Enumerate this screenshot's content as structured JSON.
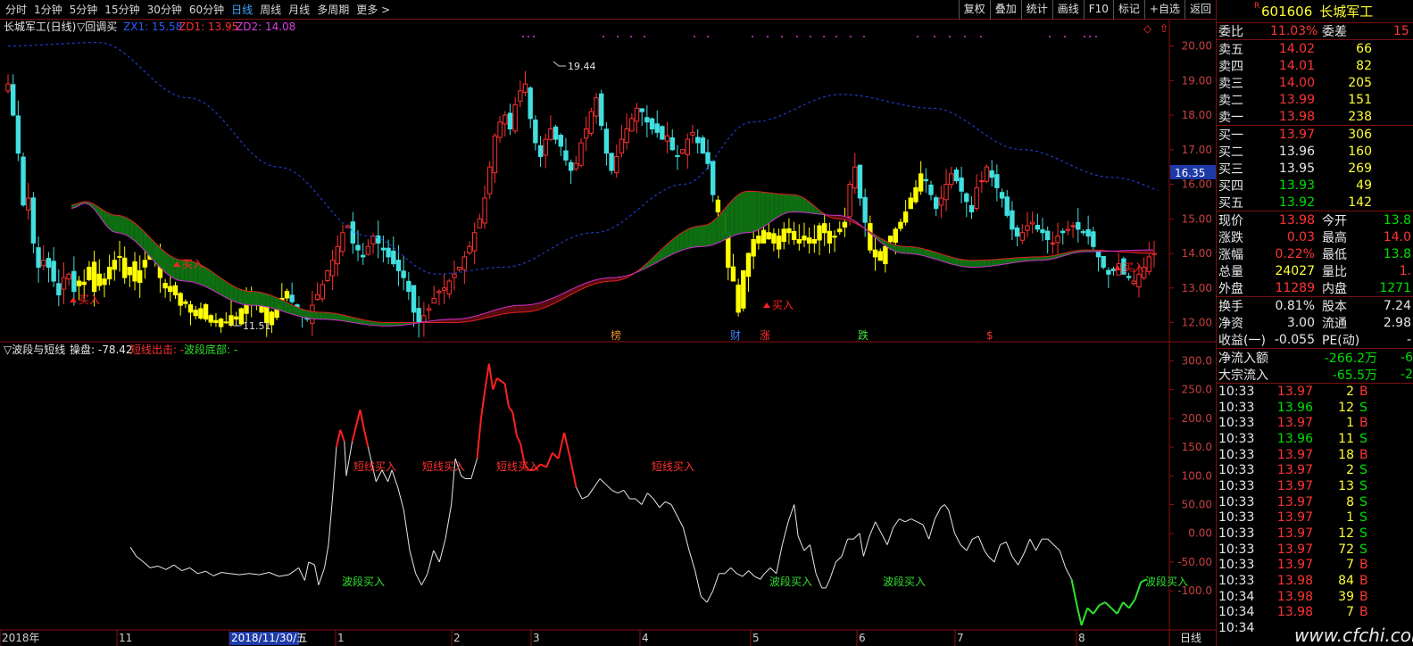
{
  "periods": [
    "分时",
    "1分钟",
    "5分钟",
    "15分钟",
    "30分钟",
    "60分钟",
    "日线",
    "周线",
    "月线",
    "多周期",
    "更多 >"
  ],
  "active_period": "日线",
  "tools": [
    "复权",
    "叠加",
    "统计",
    "画线",
    "F10",
    "标记",
    "+自选",
    "返回"
  ],
  "upper": {
    "label_name": "长城军工(日线)",
    "label_ind": "▽回调买",
    "zx1": "ZX1: 15.58",
    "zd1": "ZD1: 13.95",
    "zd2": "ZD2: 14.08",
    "y_ticks": [
      "20.00",
      "19.00",
      "18.00",
      "17.00",
      "16.00",
      "15.00",
      "14.00",
      "13.00",
      "12.00"
    ],
    "price_box": "16.35",
    "high_label": "19.44",
    "low_label": "11.51",
    "buy_label": "买入",
    "events": [
      "榜",
      "财",
      "涨",
      "跌",
      "$"
    ]
  },
  "lower": {
    "label_ind": "▽波段与短线",
    "label_op": "操盘: -78.42",
    "label_short": "短线出击: -",
    "label_wave": "波段底部: -",
    "y_ticks": [
      "300.0",
      "250.0",
      "200.0",
      "150.0",
      "100.0",
      "50.00",
      "0.00",
      "-50.00",
      "-100.0"
    ],
    "short_buy": "短线买入",
    "wave_buy": "波段买入"
  },
  "xaxis": {
    "labels": [
      "2018年",
      "11",
      "2018/11/30/五",
      "1",
      "2",
      "3",
      "4",
      "5",
      "6",
      "7",
      "8"
    ],
    "right": "日线"
  },
  "panel": {
    "code": "601606",
    "name": "长城军工",
    "rmark": "R",
    "weibi_label": "委比",
    "weibi": "11.03%",
    "weicha_label": "委差",
    "weicha": "15",
    "asks": [
      {
        "l": "卖五",
        "p": "14.02",
        "v": "66"
      },
      {
        "l": "卖四",
        "p": "14.01",
        "v": "82"
      },
      {
        "l": "卖三",
        "p": "14.00",
        "v": "205"
      },
      {
        "l": "卖二",
        "p": "13.99",
        "v": "151"
      },
      {
        "l": "卖一",
        "p": "13.98",
        "v": "238"
      }
    ],
    "bids": [
      {
        "l": "买一",
        "p": "13.97",
        "v": "306"
      },
      {
        "l": "买二",
        "p": "13.96",
        "v": "160"
      },
      {
        "l": "买三",
        "p": "13.95",
        "v": "269"
      },
      {
        "l": "买四",
        "p": "13.93",
        "v": "49"
      },
      {
        "l": "买五",
        "p": "13.92",
        "v": "142"
      }
    ],
    "quote": [
      {
        "l1": "现价",
        "v1": "13.98",
        "c1": "red",
        "l2": "今开",
        "v2": "13.8",
        "c2": "green"
      },
      {
        "l1": "涨跌",
        "v1": "0.03",
        "c1": "red",
        "l2": "最高",
        "v2": "14.0",
        "c2": "red"
      },
      {
        "l1": "涨幅",
        "v1": "0.22%",
        "c1": "red",
        "l2": "最低",
        "v2": "13.8",
        "c2": "green"
      },
      {
        "l1": "总量",
        "v1": "24027",
        "c1": "yellow",
        "l2": "量比",
        "v2": "1.",
        "c2": "red"
      },
      {
        "l1": "外盘",
        "v1": "11289",
        "c1": "red",
        "l2": "内盘",
        "v2": "1271",
        "c2": "green"
      }
    ],
    "info": [
      {
        "l1": "换手",
        "v1": "0.81%",
        "l2": "股本",
        "v2": "7.24"
      },
      {
        "l1": "净资",
        "v1": "3.00",
        "l2": "流通",
        "v2": "2.98"
      },
      {
        "l1": "收益(一)",
        "v1": "-0.055",
        "l2": "PE(动)",
        "v2": "-"
      }
    ],
    "flow": [
      {
        "l": "净流入额",
        "v": "-266.2万",
        "x": "-6"
      },
      {
        "l": "大宗流入",
        "v": "-65.5万",
        "x": "-2"
      }
    ],
    "ticks": [
      {
        "t": "10:33",
        "p": "13.97",
        "v": "2",
        "s": "B"
      },
      {
        "t": "10:33",
        "p": "13.96",
        "v": "12",
        "s": "S"
      },
      {
        "t": "10:33",
        "p": "13.97",
        "v": "1",
        "s": "B"
      },
      {
        "t": "10:33",
        "p": "13.96",
        "v": "11",
        "s": "S"
      },
      {
        "t": "10:33",
        "p": "13.97",
        "v": "18",
        "s": "B"
      },
      {
        "t": "10:33",
        "p": "13.97",
        "v": "2",
        "s": "S"
      },
      {
        "t": "10:33",
        "p": "13.97",
        "v": "13",
        "s": "S"
      },
      {
        "t": "10:33",
        "p": "13.97",
        "v": "8",
        "s": "S"
      },
      {
        "t": "10:33",
        "p": "13.97",
        "v": "1",
        "s": "S"
      },
      {
        "t": "10:33",
        "p": "13.97",
        "v": "12",
        "s": "S"
      },
      {
        "t": "10:33",
        "p": "13.97",
        "v": "72",
        "s": "S"
      },
      {
        "t": "10:33",
        "p": "13.97",
        "v": "7",
        "s": "B"
      },
      {
        "t": "10:33",
        "p": "13.98",
        "v": "84",
        "s": "B"
      },
      {
        "t": "10:34",
        "p": "13.98",
        "v": "39",
        "s": "B"
      },
      {
        "t": "10:34",
        "p": "13.98",
        "v": "7",
        "s": "B"
      },
      {
        "t": "10:34",
        "p": "",
        "v": "",
        "s": ""
      }
    ]
  },
  "watermark": "www.cfchi.com",
  "chart_data": {
    "type": "candlestick",
    "upper_ylim": [
      11.6,
      20.4
    ],
    "closes": [
      18.9,
      18.0,
      16.9,
      15.4,
      15.6,
      14.3,
      13.6,
      13.8,
      13.6,
      13.2,
      12.8,
      13.3,
      13.4,
      12.9,
      13.2,
      13.1,
      13.6,
      12.9,
      13.4,
      13.1,
      13.6,
      13.8,
      13.9,
      13.3,
      13.6,
      13.2,
      13.5,
      13.8,
      14.0,
      13.9,
      13.3,
      13.0,
      12.9,
      12.8,
      12.5,
      12.6,
      12.3,
      12.2,
      12.4,
      12.1,
      12.2,
      12.0,
      12.1,
      12.0,
      12.2,
      12.1,
      12.4,
      12.6,
      12.8,
      12.5,
      12.3,
      12.0,
      12.3,
      12.5,
      12.7,
      12.9,
      12.6,
      12.4,
      12.3,
      12.1,
      12.5,
      12.8,
      13.1,
      13.5,
      13.8,
      14.2,
      14.6,
      14.8,
      14.3,
      14.1,
      13.9,
      14.2,
      14.5,
      14.3,
      14.1,
      13.9,
      13.7,
      13.5,
      13.3,
      12.9,
      12.3,
      12.0,
      12.2,
      12.4,
      12.7,
      12.9,
      13.0,
      13.2,
      13.4,
      13.6,
      13.9,
      14.2,
      14.6,
      15.0,
      15.6,
      16.5,
      17.4,
      17.8,
      18.0,
      17.6,
      18.3,
      18.7,
      18.9,
      17.9,
      17.2,
      16.8,
      17.3,
      17.6,
      17.3,
      17.1,
      16.7,
      16.4,
      16.6,
      17.2,
      17.6,
      18.1,
      18.5,
      17.7,
      16.9,
      16.4,
      16.8,
      17.3,
      17.6,
      17.9,
      18.2,
      18.1,
      17.8,
      17.6,
      17.5,
      17.3,
      17.4,
      17.0,
      16.8,
      17.0,
      17.3,
      17.5,
      17.2,
      16.9,
      16.6,
      15.7,
      15.2,
      14.6,
      13.6,
      13.2,
      12.3,
      13.5,
      14.0,
      14.4,
      14.5,
      14.3,
      14.6,
      14.3,
      14.5,
      14.7,
      14.6,
      14.4,
      14.3,
      14.5,
      14.3,
      14.4,
      14.8,
      14.6,
      14.3,
      14.5,
      14.7,
      14.9,
      16.0,
      16.5,
      15.6,
      14.9,
      14.1,
      13.9,
      13.8,
      14.2,
      14.5,
      14.7,
      14.9,
      15.2,
      15.6,
      15.9,
      16.3,
      16.1,
      15.7,
      15.3,
      15.6,
      16.0,
      16.3,
      16.1,
      15.8,
      15.5,
      15.2,
      15.9,
      16.1,
      16.5,
      16.2,
      15.9,
      15.6,
      15.1,
      14.7,
      14.5,
      14.6,
      14.8,
      14.9,
      14.7,
      14.6,
      14.4,
      14.3,
      14.5,
      14.6,
      14.7,
      14.8,
      14.7,
      14.6,
      14.5,
      14.2,
      13.9,
      13.6,
      13.4,
      13.5,
      13.7,
      13.4,
      13.3,
      13.2,
      13.4,
      13.6,
      13.9,
      14.0
    ],
    "lower_ylim": [
      -165,
      310
    ],
    "lower_ticks": [
      300,
      250,
      200,
      150,
      100,
      50,
      0,
      -50,
      -100
    ]
  }
}
